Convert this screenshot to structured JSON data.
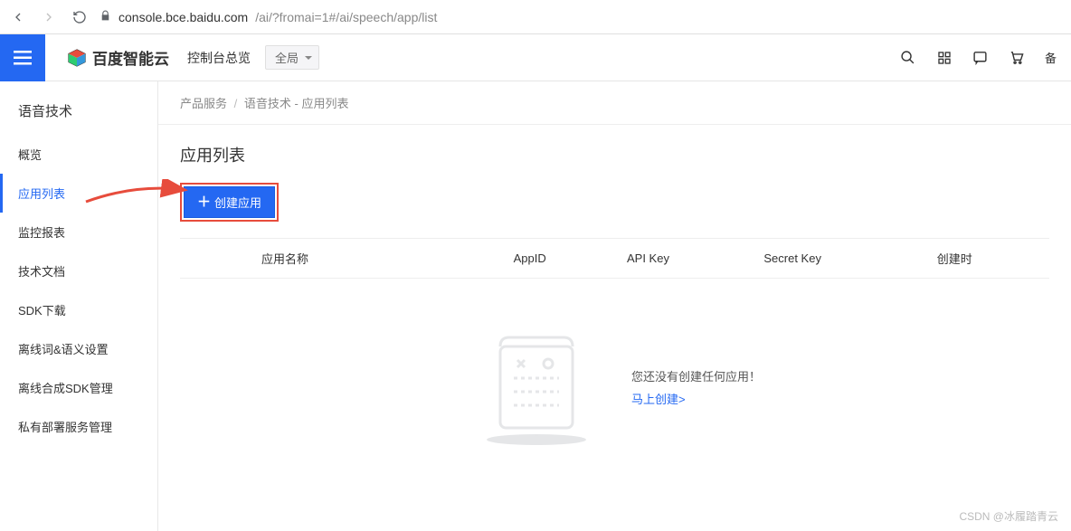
{
  "browser": {
    "url_host": "console.bce.baidu.com",
    "url_path": "/ai/?fromai=1#/ai/speech/app/list"
  },
  "header": {
    "brand": "百度智能云",
    "console": "控制台总览",
    "scope": "全局",
    "backup_label": "备"
  },
  "sidebar": {
    "group_title": "语音技术",
    "items": [
      {
        "label": "概览"
      },
      {
        "label": "应用列表"
      },
      {
        "label": "监控报表"
      },
      {
        "label": "技术文档"
      },
      {
        "label": "SDK下载"
      },
      {
        "label": "离线词&语义设置"
      },
      {
        "label": "离线合成SDK管理"
      },
      {
        "label": "私有部署服务管理"
      }
    ],
    "active_index": 1
  },
  "breadcrumb": {
    "root": "产品服务",
    "current": "语音技术 - 应用列表"
  },
  "page": {
    "title": "应用列表",
    "create_button": "创建应用"
  },
  "table": {
    "columns": [
      "应用名称",
      "AppID",
      "API Key",
      "Secret Key",
      "创建时"
    ],
    "empty_message": "您还没有创建任何应用！",
    "empty_link": "马上创建>"
  },
  "watermark": "CSDN @冰履踏青云"
}
